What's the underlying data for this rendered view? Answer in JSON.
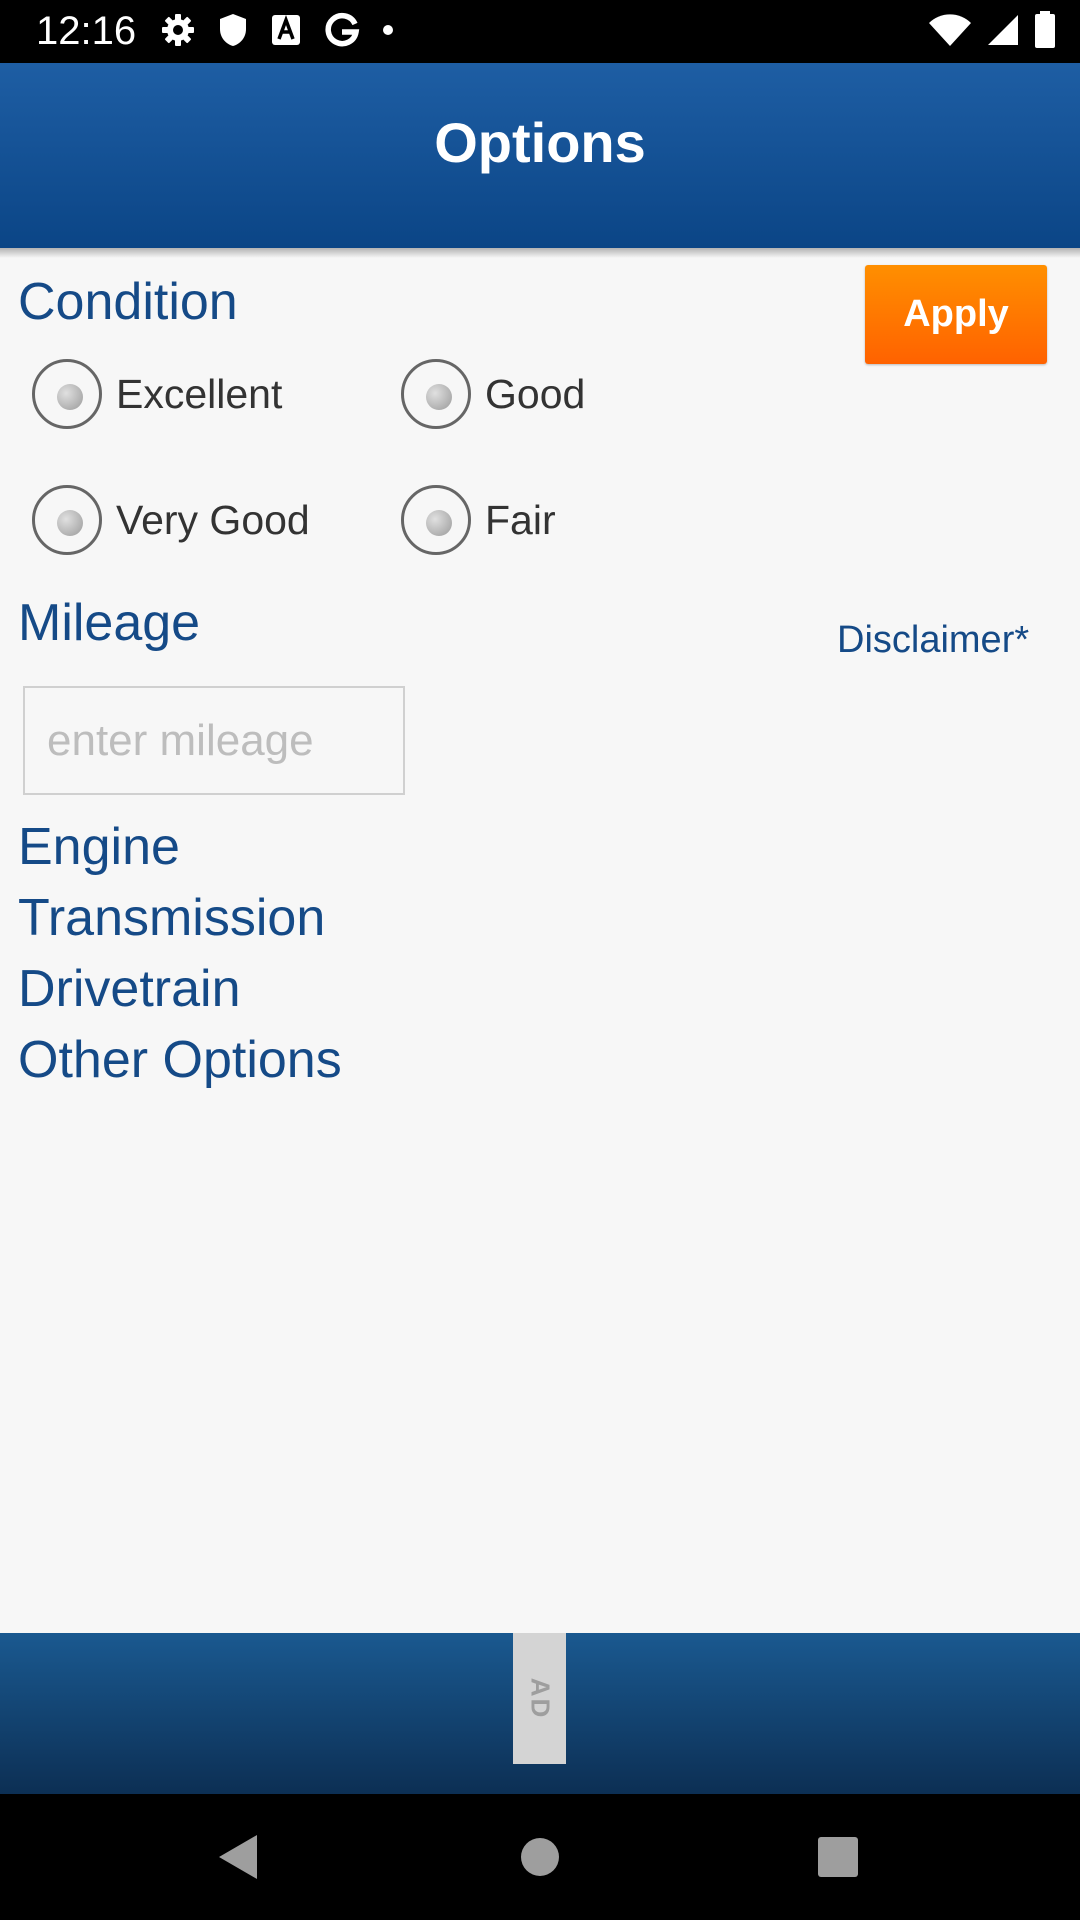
{
  "status_bar": {
    "time": "12:16",
    "icons_left": [
      "gear-icon",
      "shield-icon",
      "font-a-icon",
      "google-g-icon",
      "dot-icon"
    ],
    "icons_right": [
      "wifi-icon",
      "signal-icon",
      "battery-icon"
    ]
  },
  "header": {
    "title": "Options"
  },
  "condition": {
    "title": "Condition",
    "options": [
      "Excellent",
      "Good",
      "Very Good",
      "Fair"
    ],
    "selected": null
  },
  "apply_label": "Apply",
  "mileage": {
    "title": "Mileage",
    "placeholder": "enter mileage",
    "value": "",
    "disclaimer_label": "Disclaimer*"
  },
  "sections": [
    "Engine",
    "Transmission",
    "Drivetrain",
    "Other Options"
  ],
  "ad": {
    "label": "AD"
  },
  "colors": {
    "header_top": "#1e5ea4",
    "header_bottom": "#0b4586",
    "accent_text": "#154a87",
    "apply_top": "#ff8f00",
    "apply_bottom": "#ff6200",
    "background": "#f7f7f7"
  },
  "nav_bar": {
    "buttons": [
      "back-icon",
      "home-icon",
      "recents-icon"
    ]
  }
}
